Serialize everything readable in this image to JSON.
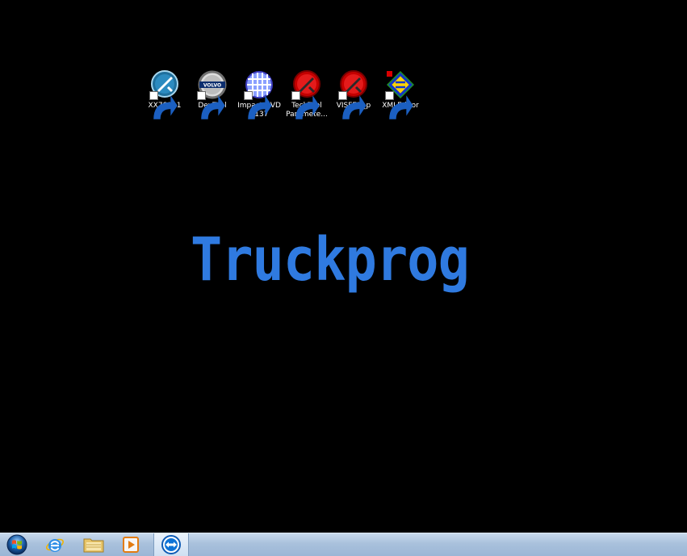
{
  "desktop": {
    "wallpaper_text": "Truckprog",
    "wallpaper_color": "#2f7ae0",
    "icons": [
      {
        "label": "XX78911",
        "icon": "wrench-tool-icon"
      },
      {
        "label": "DevTool",
        "icon": "volvo-logo-icon"
      },
      {
        "label": "Impact DVD 8137",
        "icon": "impact-grid-icon"
      },
      {
        "label": "TechTool Paramete...",
        "icon": "techtool-red-icon"
      },
      {
        "label": "VISFED_p",
        "icon": "techtool-red-icon"
      },
      {
        "label": "XMLEditor",
        "icon": "xml-editor-icon"
      }
    ]
  },
  "taskbar": {
    "buttons": [
      {
        "name": "start",
        "icon": "windows-orb-icon"
      },
      {
        "name": "internet-explorer",
        "icon": "ie-icon"
      },
      {
        "name": "file-explorer",
        "icon": "folder-icon"
      },
      {
        "name": "media-player",
        "icon": "media-player-icon"
      },
      {
        "name": "teamviewer",
        "icon": "teamviewer-icon"
      }
    ]
  }
}
